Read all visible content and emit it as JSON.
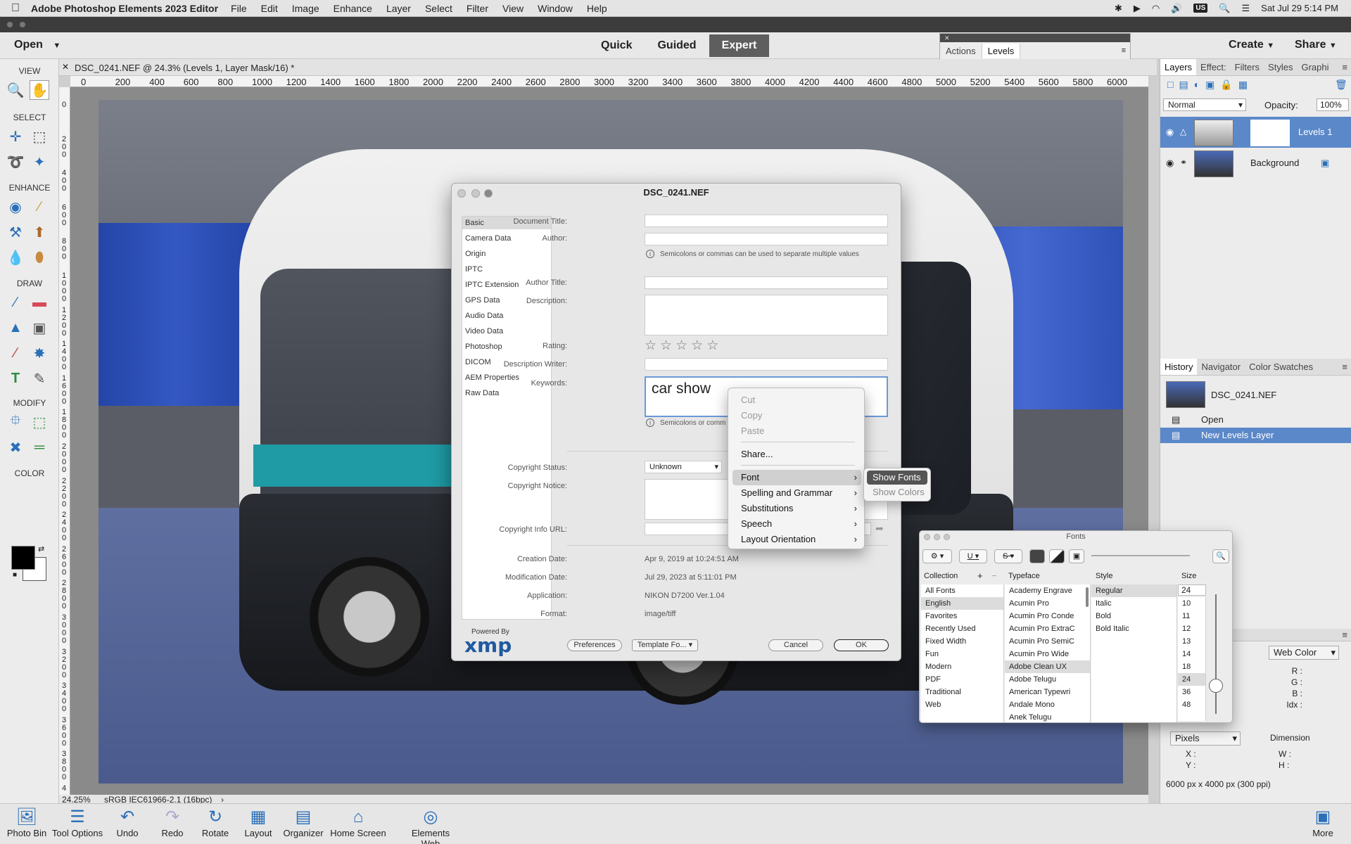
{
  "os_menubar": {
    "app_name": "Adobe Photoshop Elements 2023 Editor",
    "menus": [
      "File",
      "Edit",
      "Image",
      "Enhance",
      "Layer",
      "Select",
      "Filter",
      "View",
      "Window",
      "Help"
    ],
    "input_source": "US",
    "datetime": "Sat Jul 29  5:14 PM"
  },
  "appbar": {
    "open_label": "Open",
    "modes": [
      "Quick",
      "Guided",
      "Expert"
    ],
    "active_mode": "Expert",
    "create_label": "Create",
    "share_label": "Share"
  },
  "levels_panel": {
    "tabs": [
      "Actions",
      "Levels"
    ],
    "active_tab": "Levels"
  },
  "toolbox": {
    "sections": [
      "VIEW",
      "SELECT",
      "ENHANCE",
      "DRAW",
      "MODIFY",
      "COLOR"
    ]
  },
  "document": {
    "tab_title": "DSC_0241.NEF @ 24.3% (Levels 1, Layer Mask/16) *",
    "ruler_h": [
      "0",
      "200",
      "400",
      "600",
      "800",
      "1000",
      "1200",
      "1400",
      "1600",
      "1800",
      "2000",
      "2200",
      "2400",
      "2600",
      "2800",
      "3000",
      "3200",
      "3400",
      "3600",
      "3800",
      "4000",
      "4200",
      "4400",
      "4600",
      "4800",
      "5000",
      "5200",
      "5400",
      "5600",
      "5800",
      "6000"
    ],
    "ruler_v": [
      "0",
      "2\n0\n0",
      "4\n0\n0",
      "6\n0\n0",
      "8\n0\n0",
      "1\n0\n0\n0",
      "1\n2\n0\n0",
      "1\n4\n0\n0",
      "1\n6\n0\n0",
      "1\n8\n0\n0",
      "2\n0\n0\n0",
      "2\n2\n0\n0",
      "2\n4\n0\n0",
      "2\n6\n0\n0",
      "2\n8\n0\n0",
      "3\n0\n0\n0",
      "3\n2\n0\n0",
      "3\n4\n0\n0",
      "3\n6\n0\n0",
      "3\n8\n0\n0",
      "4"
    ],
    "zoom": "24.25%",
    "color_profile": "sRGB IEC61966-2.1 (16bpc)"
  },
  "layers_panel": {
    "tabs": [
      "Layers",
      "Effect:",
      "Filters",
      "Styles",
      "Graphi"
    ],
    "blend_mode": "Normal",
    "opacity_label": "Opacity:",
    "opacity": "100%",
    "layers": [
      {
        "name": "Levels 1",
        "selected": true
      },
      {
        "name": "Background",
        "selected": false
      }
    ]
  },
  "history_panel": {
    "tabs": [
      "History",
      "Navigator",
      "Color Swatches"
    ],
    "document_name": "DSC_0241.NEF",
    "steps": [
      {
        "label": "Open",
        "selected": false
      },
      {
        "label": "New Levels Layer",
        "selected": true
      }
    ]
  },
  "info_panel": {
    "color_mode": "Web Color",
    "rgb_labels": [
      "R :",
      "G :",
      "B :",
      "Idx :"
    ],
    "unit": "Pixels",
    "dimension_label": "Dimension",
    "xy_labels": [
      "X :",
      "Y :"
    ],
    "wh_labels": [
      "W :",
      "H :"
    ],
    "doc_size": "6000 px x 4000 px (300 ppi)"
  },
  "bottombar": {
    "buttons": [
      "Photo Bin",
      "Tool Options",
      "Undo",
      "Redo",
      "Rotate",
      "Layout",
      "Organizer",
      "Home Screen",
      "Elements Web"
    ],
    "more_label": "More"
  },
  "file_info_dialog": {
    "title": "DSC_0241.NEF",
    "nav": [
      "Basic",
      "Camera Data",
      "Origin",
      "IPTC",
      "IPTC Extension",
      "GPS Data",
      "Audio Data",
      "Video Data",
      "Photoshop",
      "DICOM",
      "AEM Properties",
      "Raw Data"
    ],
    "selected_nav": "Basic",
    "labels": {
      "doc_title": "Document Title:",
      "author": "Author:",
      "author_title": "Author Title:",
      "description": "Description:",
      "rating": "Rating:",
      "desc_writer": "Description Writer:",
      "keywords": "Keywords:",
      "copyright_status": "Copyright Status:",
      "copyright_notice": "Copyright Notice:",
      "copyright_url": "Copyright Info URL:",
      "creation_date": "Creation Date:",
      "modification_date": "Modification Date:",
      "application": "Application:",
      "format": "Format:"
    },
    "author_note": "Semicolons or commas can be used to separate multiple values",
    "keywords_note": "Semicolons or comm",
    "keywords_value": "car show",
    "copyright_status_value": "Unknown",
    "creation_date_value": "Apr 9, 2019 at 10:24:51 AM",
    "modification_date_value": "Jul 29, 2023 at 5:11:01 PM",
    "application_value": "NIKON D7200 Ver.1.04",
    "format_value": "image/tiff",
    "powered_by": "Powered By",
    "xmp": "xmp",
    "preferences_label": "Preferences",
    "template_label": "Template Fo...",
    "cancel_label": "Cancel",
    "ok_label": "OK"
  },
  "context_menu": {
    "items": [
      "Cut",
      "Copy",
      "Paste",
      "Share...",
      "Font",
      "Spelling and Grammar",
      "Substitutions",
      "Speech",
      "Layout Orientation"
    ],
    "submenu": [
      "Show Fonts",
      "Show Colors"
    ]
  },
  "fonts_panel": {
    "title": "Fonts",
    "col_headers": [
      "Collection",
      "Typeface",
      "Style",
      "Size"
    ],
    "size_value": "24",
    "collections": [
      "All Fonts",
      "English",
      "Favorites",
      "Recently Used",
      "Fixed Width",
      "Fun",
      "Modern",
      "PDF",
      "Traditional",
      "Web"
    ],
    "selected_collection": "English",
    "typefaces": [
      "Academy Engrave",
      "Acumin Pro",
      "Acumin Pro Conde",
      "Acumin Pro ExtraC",
      "Acumin Pro SemiC",
      "Acumin Pro Wide",
      "Adobe Clean UX",
      "Adobe Telugu",
      "American Typewri",
      "Andale Mono",
      "Anek Telugu"
    ],
    "selected_typeface": "Adobe Clean UX",
    "styles": [
      "Regular",
      "Italic",
      "Bold",
      "Bold Italic"
    ],
    "selected_style": "Regular",
    "sizes": [
      "10",
      "11",
      "12",
      "13",
      "14",
      "18",
      "24",
      "36",
      "48"
    ],
    "selected_size": "24"
  }
}
